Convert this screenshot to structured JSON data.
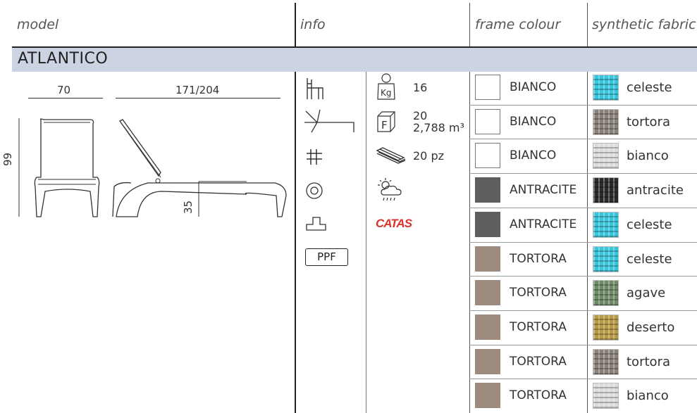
{
  "headers": {
    "model": "model",
    "info": "info",
    "frame_colour": "frame colour",
    "synthetic_fabric": "synthetic fabric"
  },
  "product": {
    "name": "ATLANTICO",
    "dimensions": {
      "width": "70",
      "length": "171/204",
      "height": "99",
      "seat_height": "35"
    }
  },
  "specs": {
    "weight": "16",
    "volume_pieces": "20",
    "volume": "2,788 m³",
    "stack": "20 pz",
    "ppf": "PPF",
    "catas": "CATAS"
  },
  "icons": [
    "chair-outline-icon",
    "recline-icon",
    "grid-icon",
    "target-icon",
    "base-icon",
    "weight-icon",
    "volume-box-icon",
    "stack-icon",
    "weather-icon",
    "catas-logo"
  ],
  "rows": [
    {
      "frame": "BIANCO",
      "frame_color": "#ffffff",
      "fabric": "celeste",
      "fabric_color": "#36c6dc"
    },
    {
      "frame": "BIANCO",
      "frame_color": "#ffffff",
      "fabric": "tortora",
      "fabric_color": "#8a8278"
    },
    {
      "frame": "BIANCO",
      "frame_color": "#ffffff",
      "fabric": "bianco",
      "fabric_color": "#dcdcdc"
    },
    {
      "frame": "ANTRACITE",
      "frame_color": "#5e5e5e",
      "fabric": "antracite",
      "fabric_color": "#2b2b2b"
    },
    {
      "frame": "ANTRACITE",
      "frame_color": "#5e5e5e",
      "fabric": "celeste",
      "fabric_color": "#36c6dc"
    },
    {
      "frame": "TORTORA",
      "frame_color": "#9e8b7f",
      "fabric": "celeste",
      "fabric_color": "#36c6dc"
    },
    {
      "frame": "TORTORA",
      "frame_color": "#9e8b7f",
      "fabric": "agave",
      "fabric_color": "#6f8a66"
    },
    {
      "frame": "TORTORA",
      "frame_color": "#9e8b7f",
      "fabric": "deserto",
      "fabric_color": "#b79a46"
    },
    {
      "frame": "TORTORA",
      "frame_color": "#9e8b7f",
      "fabric": "tortora",
      "fabric_color": "#8a8278"
    },
    {
      "frame": "TORTORA",
      "frame_color": "#9e8b7f",
      "fabric": "bianco",
      "fabric_color": "#dcdcdc"
    }
  ]
}
